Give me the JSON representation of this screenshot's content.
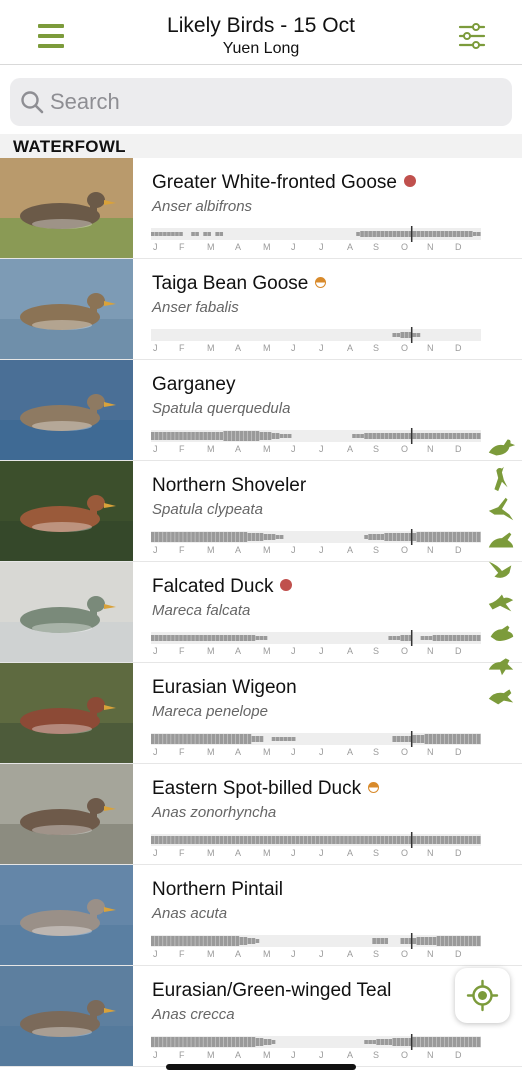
{
  "header": {
    "title": "Likely Birds - 15 Oct",
    "subtitle": "Yuen Long",
    "menu_icon": "hamburger-menu-icon",
    "filter_icon": "sliders-filter-icon"
  },
  "search": {
    "placeholder": "Search",
    "value": ""
  },
  "section": {
    "title": "WATERFOWL"
  },
  "months": [
    "J",
    "F",
    "M",
    "A",
    "M",
    "J",
    "J",
    "A",
    "S",
    "O",
    "N",
    "D"
  ],
  "today_position_fraction": 0.79,
  "colors": {
    "accent": "#7c9b3b",
    "rare_dot": "#c0504d",
    "uncommon_dot": "#d88a2b",
    "bar": "#9a9a9a",
    "track": "#eeeeee"
  },
  "birds": [
    {
      "name": "Greater White-fronted Goose",
      "scientific": "Anser albifrons",
      "status": "rare",
      "thumb_colors": {
        "bg": "#b99a6c",
        "water": "#8a9a55",
        "bird": "#6b5a48"
      },
      "frequency": [
        2,
        2,
        2,
        2,
        2,
        2,
        2,
        2,
        0,
        0,
        2,
        2,
        0,
        2,
        2,
        0,
        2,
        2,
        0,
        0,
        0,
        0,
        0,
        0,
        0,
        0,
        0,
        0,
        0,
        0,
        0,
        0,
        0,
        0,
        0,
        0,
        0,
        0,
        0,
        0,
        0,
        0,
        0,
        0,
        0,
        0,
        0,
        0,
        0,
        0,
        0,
        2,
        3,
        3,
        3,
        3,
        3,
        3,
        3,
        3,
        3,
        3,
        3,
        3,
        3,
        3,
        3,
        3,
        3,
        3,
        3,
        3,
        3,
        3,
        3,
        3,
        3,
        3,
        3,
        3,
        2,
        2
      ]
    },
    {
      "name": "Taiga Bean Goose",
      "scientific": "Anser fabalis",
      "status": "uncommon",
      "thumb_colors": {
        "bg": "#7d9bb5",
        "water": "#6f8faa",
        "bird": "#8b7355"
      },
      "frequency": [
        0,
        0,
        0,
        0,
        0,
        0,
        0,
        0,
        0,
        0,
        0,
        0,
        0,
        0,
        0,
        0,
        0,
        0,
        0,
        0,
        0,
        0,
        0,
        0,
        0,
        0,
        0,
        0,
        0,
        0,
        0,
        0,
        0,
        0,
        0,
        0,
        0,
        0,
        0,
        0,
        0,
        0,
        0,
        0,
        0,
        0,
        0,
        0,
        0,
        0,
        0,
        0,
        0,
        0,
        0,
        0,
        0,
        0,
        0,
        0,
        2,
        2,
        3,
        3,
        3,
        2,
        2,
        0,
        0,
        0,
        0,
        0,
        0,
        0,
        0,
        0,
        0,
        0,
        0,
        0,
        0,
        0
      ]
    },
    {
      "name": "Garganey",
      "scientific": "Spatula querquedula",
      "status": "",
      "thumb_colors": {
        "bg": "#4a6f96",
        "water": "#3f6a94",
        "bird": "#8e7a62"
      },
      "frequency": [
        4,
        4,
        4,
        4,
        4,
        4,
        4,
        4,
        4,
        4,
        4,
        4,
        4,
        4,
        4,
        4,
        4,
        4,
        5,
        5,
        5,
        5,
        5,
        5,
        5,
        5,
        5,
        4,
        4,
        4,
        3,
        3,
        2,
        2,
        2,
        0,
        0,
        0,
        0,
        0,
        0,
        0,
        0,
        0,
        0,
        0,
        0,
        0,
        0,
        0,
        2,
        2,
        2,
        3,
        3,
        3,
        3,
        3,
        3,
        3,
        3,
        3,
        3,
        3,
        3,
        3,
        3,
        3,
        3,
        3,
        3,
        3,
        3,
        3,
        3,
        3,
        3,
        3,
        3,
        3,
        3,
        3
      ]
    },
    {
      "name": "Northern Shoveler",
      "scientific": "Spatula clypeata",
      "status": "",
      "thumb_colors": {
        "bg": "#3c4f2c",
        "water": "#35482a",
        "bird": "#9a5a3a"
      },
      "frequency": [
        5,
        5,
        5,
        5,
        5,
        5,
        5,
        5,
        5,
        5,
        5,
        5,
        5,
        5,
        5,
        5,
        5,
        5,
        5,
        5,
        5,
        5,
        5,
        5,
        4,
        4,
        4,
        4,
        3,
        3,
        3,
        2,
        2,
        0,
        0,
        0,
        0,
        0,
        0,
        0,
        0,
        0,
        0,
        0,
        0,
        0,
        0,
        0,
        0,
        0,
        0,
        0,
        0,
        2,
        3,
        3,
        3,
        3,
        4,
        4,
        4,
        4,
        4,
        4,
        4,
        4,
        5,
        5,
        5,
        5,
        5,
        5,
        5,
        5,
        5,
        5,
        5,
        5,
        5,
        5,
        5,
        5
      ]
    },
    {
      "name": "Falcated Duck",
      "scientific": "Mareca falcata",
      "status": "rare",
      "thumb_colors": {
        "bg": "#d8d8d4",
        "water": "#cfd2d2",
        "bird": "#7a8a7a"
      },
      "frequency": [
        3,
        3,
        3,
        3,
        3,
        3,
        3,
        3,
        3,
        3,
        3,
        3,
        3,
        3,
        3,
        3,
        3,
        3,
        3,
        3,
        3,
        3,
        3,
        3,
        3,
        3,
        2,
        2,
        2,
        0,
        0,
        0,
        0,
        0,
        0,
        0,
        0,
        0,
        0,
        0,
        0,
        0,
        0,
        0,
        0,
        0,
        0,
        0,
        0,
        0,
        0,
        0,
        0,
        0,
        0,
        0,
        0,
        0,
        0,
        2,
        2,
        2,
        3,
        3,
        3,
        0,
        0,
        2,
        2,
        2,
        3,
        3,
        3,
        3,
        3,
        3,
        3,
        3,
        3,
        3,
        3,
        3
      ]
    },
    {
      "name": "Eurasian Wigeon",
      "scientific": "Mareca penelope",
      "status": "",
      "thumb_colors": {
        "bg": "#5e6a40",
        "water": "#4d5b3a",
        "bird": "#8c4a36"
      },
      "frequency": [
        5,
        5,
        5,
        5,
        5,
        5,
        5,
        5,
        5,
        5,
        5,
        5,
        5,
        5,
        5,
        5,
        5,
        5,
        5,
        5,
        5,
        5,
        5,
        5,
        5,
        3,
        3,
        3,
        0,
        0,
        2,
        2,
        2,
        2,
        2,
        2,
        0,
        0,
        0,
        0,
        0,
        0,
        0,
        0,
        0,
        0,
        0,
        0,
        0,
        0,
        0,
        0,
        0,
        0,
        0,
        0,
        0,
        0,
        0,
        0,
        3,
        3,
        3,
        3,
        3,
        4,
        4,
        4,
        5,
        5,
        5,
        5,
        5,
        5,
        5,
        5,
        5,
        5,
        5,
        5,
        5,
        5
      ]
    },
    {
      "name": "Eastern Spot-billed Duck",
      "scientific": "Anas zonorhyncha",
      "status": "uncommon",
      "thumb_colors": {
        "bg": "#a5a59a",
        "water": "#8c8c80",
        "bird": "#6e5a4a"
      },
      "frequency": [
        4,
        4,
        4,
        4,
        4,
        4,
        4,
        4,
        4,
        4,
        4,
        4,
        4,
        4,
        4,
        4,
        4,
        4,
        4,
        4,
        4,
        4,
        4,
        4,
        4,
        4,
        4,
        4,
        4,
        4,
        4,
        4,
        4,
        4,
        4,
        4,
        4,
        4,
        4,
        4,
        4,
        4,
        4,
        4,
        4,
        4,
        4,
        4,
        4,
        4,
        4,
        4,
        4,
        4,
        4,
        4,
        4,
        4,
        4,
        4,
        4,
        4,
        4,
        4,
        4,
        4,
        4,
        4,
        4,
        4,
        4,
        4,
        4,
        4,
        4,
        4,
        4,
        4,
        4,
        4,
        4,
        4
      ]
    },
    {
      "name": "Northern Pintail",
      "scientific": "Anas acuta",
      "status": "",
      "thumb_colors": {
        "bg": "#6486a8",
        "water": "#5a7fa2",
        "bird": "#9a9088"
      },
      "frequency": [
        5,
        5,
        5,
        5,
        5,
        5,
        5,
        5,
        5,
        5,
        5,
        5,
        5,
        5,
        5,
        5,
        5,
        5,
        5,
        5,
        5,
        5,
        4,
        4,
        3,
        3,
        2,
        0,
        0,
        0,
        0,
        0,
        0,
        0,
        0,
        0,
        0,
        0,
        0,
        0,
        0,
        0,
        0,
        0,
        0,
        0,
        0,
        0,
        0,
        0,
        0,
        0,
        0,
        0,
        0,
        3,
        3,
        3,
        3,
        0,
        0,
        0,
        3,
        3,
        3,
        3,
        4,
        4,
        4,
        4,
        4,
        5,
        5,
        5,
        5,
        5,
        5,
        5,
        5,
        5,
        5,
        5
      ]
    },
    {
      "name": "Eurasian/Green-winged Teal",
      "scientific": "Anas crecca",
      "status": "",
      "thumb_colors": {
        "bg": "#5d7f9f",
        "water": "#557a9c",
        "bird": "#7b6a5a"
      },
      "frequency": [
        5,
        5,
        5,
        5,
        5,
        5,
        5,
        5,
        5,
        5,
        5,
        5,
        5,
        5,
        5,
        5,
        5,
        5,
        5,
        5,
        5,
        5,
        5,
        5,
        5,
        5,
        4,
        4,
        3,
        3,
        2,
        0,
        0,
        0,
        0,
        0,
        0,
        0,
        0,
        0,
        0,
        0,
        0,
        0,
        0,
        0,
        0,
        0,
        0,
        0,
        0,
        0,
        0,
        2,
        2,
        2,
        3,
        3,
        3,
        3,
        4,
        4,
        4,
        4,
        4,
        5,
        5,
        5,
        5,
        5,
        5,
        5,
        5,
        5,
        5,
        5,
        5,
        5,
        5,
        5,
        5,
        5
      ]
    }
  ],
  "side_shortcuts": [
    "duck-icon",
    "heron-icon",
    "egret-icon",
    "pigeon-icon",
    "raptor-icon",
    "swift-icon",
    "kingfisher-icon",
    "songbird-icon",
    "finch-icon"
  ],
  "location_button_icon": "locate-icon"
}
